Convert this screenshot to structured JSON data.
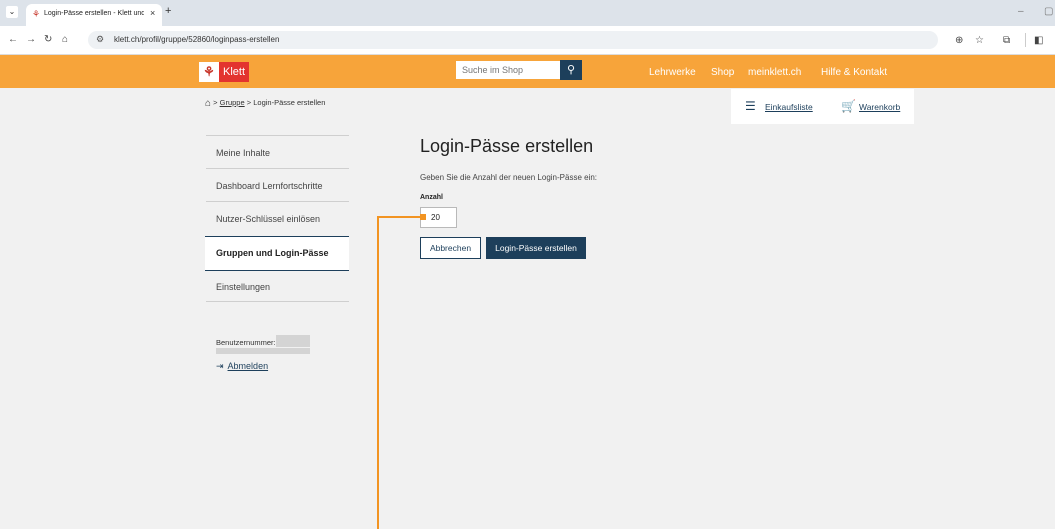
{
  "browser": {
    "tab_title": "Login-Pässe erstellen - Klett und",
    "tab_close": "×",
    "new_tab": "+",
    "url": "klett.ch/profil/gruppe/52860/loginpass-erstellen",
    "minimize": "–",
    "restore": "▢"
  },
  "header": {
    "logo_text": "Klett",
    "search_placeholder": "Suche im Shop",
    "nav": [
      "Lehrwerke",
      "Shop",
      "meinklett.ch",
      "Hilfe & Kontakt"
    ]
  },
  "breadcrumb": {
    "items": [
      "Gruppe",
      "Login-Pässe erstellen"
    ],
    "separator": ">"
  },
  "shop": {
    "wishlist": "Einkaufsliste",
    "cart": "Warenkorb"
  },
  "sidebar": {
    "items": [
      "Meine Inhalte",
      "Dashboard Lernfortschritte",
      "Nutzer-Schlüssel einlösen",
      "Gruppen und Login-Pässe",
      "Einstellungen"
    ],
    "active_index": 3,
    "user_label": "Benutzernummer:",
    "logout": "Abmelden"
  },
  "main": {
    "title": "Login-Pässe erstellen",
    "instruction": "Geben Sie die Anzahl der neuen Login-Pässe ein:",
    "quantity_label": "Anzahl",
    "quantity_value": "20",
    "cancel_label": "Abbrechen",
    "create_label": "Login-Pässe erstellen"
  },
  "colors": {
    "header_orange": "#f7a43a",
    "brand_navy": "#1d3f5b",
    "klett_red": "#e3342f",
    "annotation_orange": "#f29422"
  },
  "icons": {
    "home": "home-icon",
    "search": "search-icon",
    "list": "list-icon",
    "cart": "cart-icon",
    "logout": "logout-icon"
  }
}
